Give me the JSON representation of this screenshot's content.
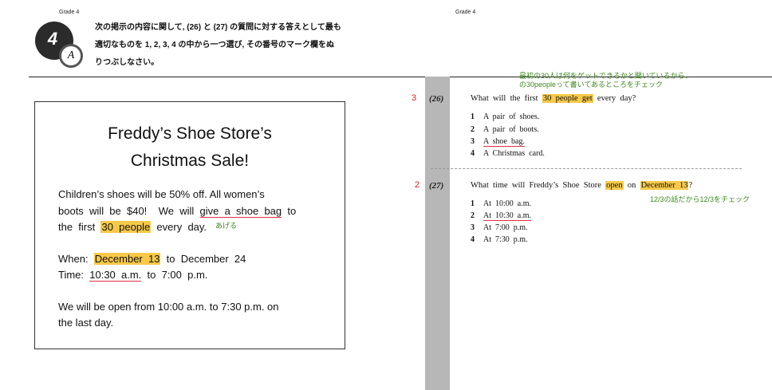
{
  "header": {
    "grade_left": "Grade 4",
    "grade_right": "Grade 4",
    "badge_number": "4",
    "badge_letter": "A",
    "instruction_line1": "次の掲示の内容に関して, (26) と (27) の質問に対する答えとして最も",
    "instruction_line2": "適切なものを 1, 2, 3, 4 の中から一つ選び, その番号のマーク欄をぬ",
    "instruction_line3": "りつぶしなさい。"
  },
  "notice": {
    "title_line1": "Freddy’s  Shoe  Store’s",
    "title_line2": "Christmas  Sale!",
    "p1_line1": "Children’s  shoes  will  be  50%  off.    All  women’s",
    "p1_line2_a": "boots  will  be  $40!    We  will  ",
    "p1_line2_ul": "give  a  shoe  bag",
    "p1_line2_b": "  to",
    "p1_line3_a": "the  first  ",
    "p1_line3_hl": "30  people",
    "p1_line3_b": "  every  day.",
    "memo_ageru": "あげる",
    "when_label": "When:  ",
    "when_hl": "December  13",
    "when_rest": "  to  December  24",
    "time_label": "Time:  ",
    "time_ul": "10:30  a.m.",
    "time_rest": "  to  7:00  p.m.",
    "p3_line1": "We  will  be  open  from  10:00  a.m.  to  7:30  p.m.  on",
    "p3_line2": "the  last  day."
  },
  "memos": {
    "q26_line1": "最初の30人は何をゲットできるかと聞いているから、",
    "q26_line2": "の30peopleって書いてあるところをチェック",
    "q27": "12/3の話だから12/3をチェック"
  },
  "questions": [
    {
      "mark": "3",
      "number": "(26)",
      "text_a": "What  will  the  first  ",
      "text_hl": "30  people  get",
      "text_b": "  every  day?",
      "options": [
        {
          "num": "1",
          "text": "A  pair  of  shoes."
        },
        {
          "num": "2",
          "text": "A  pair  of  boots."
        },
        {
          "num": "3",
          "text": "A  shoe  bag."
        },
        {
          "num": "4",
          "text": "A  Christmas  card."
        }
      ]
    },
    {
      "mark": "2",
      "number": "(27)",
      "text_a": "What  time  will  Freddy’s  Shoe  Store  ",
      "text_hl1": "open",
      "text_mid": "  on  ",
      "text_hl2": "December  13",
      "text_b": "?",
      "options": [
        {
          "num": "1",
          "text": "At  10:00  a.m."
        },
        {
          "num": "2",
          "text": "At  10:30  a.m."
        },
        {
          "num": "3",
          "text": "At  7:00  p.m."
        },
        {
          "num": "4",
          "text": "At  7:30  p.m."
        }
      ]
    }
  ]
}
